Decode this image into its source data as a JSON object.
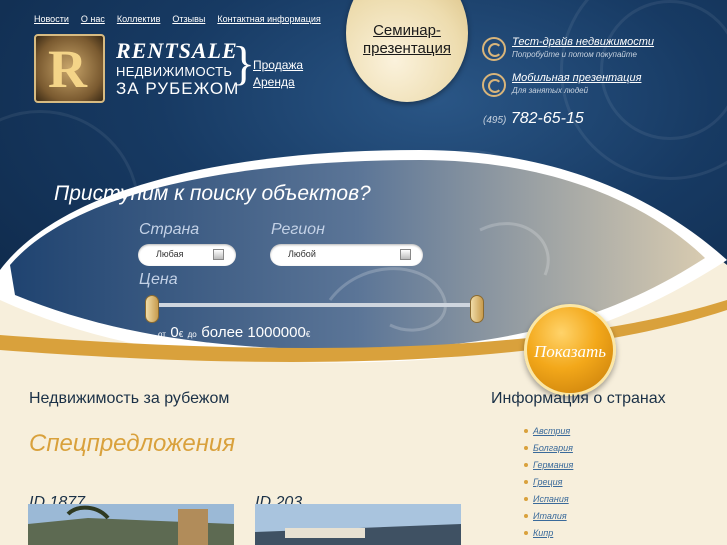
{
  "nav": {
    "items": [
      "Новости",
      "О нас",
      "Коллектив",
      "Отзывы",
      "Контактная информация"
    ]
  },
  "brand": {
    "logo_letter": "R",
    "name": "RENTSALE",
    "line2": "НЕДВИЖИМОСТЬ",
    "line3": "ЗА РУБЕЖОМ"
  },
  "sale_links": [
    "Продажа",
    "Аренда"
  ],
  "seminar": {
    "line1": "Семинар-",
    "line2": "презентация"
  },
  "promo": [
    {
      "title": "Тест-драйв недвижимости",
      "subtitle": "Попробуйте и потом покупайте",
      "icon": "swirl-icon"
    },
    {
      "title": "Мобильная презентация",
      "subtitle": "Для занятых людей",
      "icon": "swirl-icon"
    }
  ],
  "phone": {
    "code": "(495)",
    "number": "782-65-15"
  },
  "search": {
    "title": "Приступим к поиску объектов?",
    "country_label": "Страна",
    "country_value": "Любая",
    "region_label": "Регион",
    "region_value": "Любой",
    "price_label": "Цена",
    "price_from_word": "от",
    "price_min": "0",
    "price_currency": "€",
    "price_to_word": "до",
    "price_max": "более 1000000",
    "show_button": "Показать"
  },
  "left": {
    "heading": "Недвижимость за рубежом",
    "specials": "Спецпредложения"
  },
  "cards": [
    {
      "id": "ID 1877"
    },
    {
      "id": "ID 203"
    }
  ],
  "right": {
    "heading": "Информация о странах",
    "countries": [
      "Австрия",
      "Болгария",
      "Германия",
      "Греция",
      "Испания",
      "Италия",
      "Кипр"
    ]
  },
  "colors": {
    "header_bg": "#173a63",
    "gold": "#d9a13c",
    "cream": "#f7efdc",
    "button_orange": "#f3a81a"
  }
}
